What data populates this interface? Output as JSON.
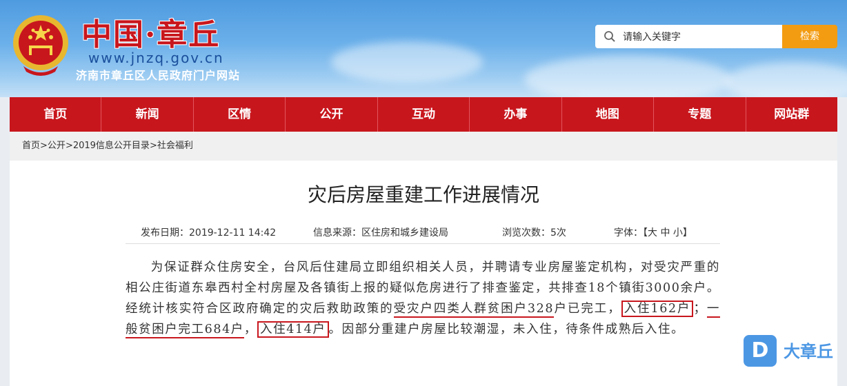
{
  "header": {
    "site_title": "中国·章丘",
    "site_url": "www.jnzq.gov.cn",
    "site_subtitle": "济南市章丘区人民政府门户网站",
    "search_placeholder": "请输入关键字",
    "search_button": "检索"
  },
  "nav": {
    "items": [
      "首页",
      "新闻",
      "区情",
      "公开",
      "互动",
      "办事",
      "地图",
      "专题",
      "网站群"
    ]
  },
  "breadcrumb": {
    "items": [
      "首页",
      "公开",
      "2019信息公开目录",
      "社会福利"
    ],
    "separator": ">"
  },
  "article": {
    "title": "灾后房屋重建工作进展情况",
    "publish_date": "发布日期：2019-12-11 14:42",
    "source": "信息来源：区住房和城乡建设局",
    "views": "浏览次数：5次",
    "font_size": "字体：【大 中 小】",
    "p1": "为保证群众住房安全，台风后住建局立即组织相关人员，并聘请专业房屋鉴定机构，对受灾严重的相公庄街道东皋西村全村房屋及各镇街上报的疑似危房进行了排查鉴定，共排查18个镇街3000余户。经统计核实符合区政府确定的灾后救助政策的",
    "hl1": "受灾户四类人群贫困户328",
    "p2": "户已完工，",
    "hl2": "入住162户",
    "p3": "；",
    "hl3": "一般贫困户完工684户",
    "p4": "，",
    "hl4": "入住414户",
    "p5": "。因部分重建户房屋比较潮湿，未入住，待条件成熟后入住。"
  },
  "watermark": {
    "text": "大章丘",
    "icon": "D"
  },
  "colors": {
    "brand_red": "#c8161d",
    "search_orange": "#f39c12"
  }
}
